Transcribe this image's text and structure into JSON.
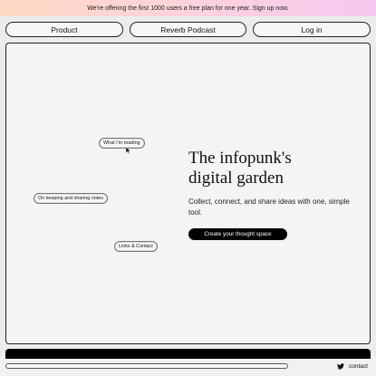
{
  "banner": {
    "text": "We're offering the first 1000 users a free plan for one year. Sign up now."
  },
  "nav": {
    "product": "Product",
    "podcast": "Reverb Podcast",
    "login": "Log in"
  },
  "canvas": {
    "pills": {
      "reading": "What I'm reading",
      "notes": "On keeping and sharing notes",
      "links": "Links & Contact"
    }
  },
  "hero": {
    "title_line1": "The infopunk's",
    "title_line2": "digital garden",
    "subtitle": "Collect, connect, and share ideas with one, simple tool.",
    "cta": "Create your thought space"
  },
  "footer": {
    "contact_label": "contact",
    "icon": "twitter-icon"
  }
}
